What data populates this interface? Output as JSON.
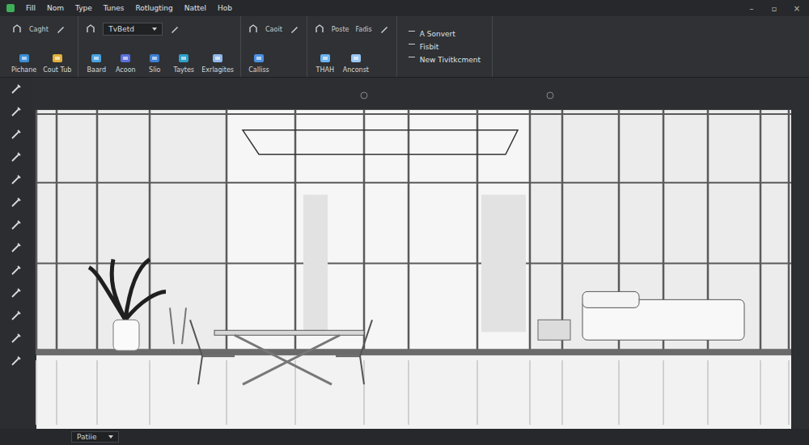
{
  "menu": [
    "Fill",
    "Nom",
    "Type",
    "Tunes",
    "Rotlugting",
    "Nattel",
    "Hob"
  ],
  "window_controls": [
    "–",
    "▫",
    "×"
  ],
  "ribbon": {
    "groups": [
      {
        "captions": [
          "Caght"
        ],
        "buttons": [
          "Pichane",
          "Cout Tub"
        ]
      },
      {
        "captions": [],
        "dropdown": "TvBetd",
        "buttons": [
          "Baard",
          "Acoon",
          "Slio",
          "Taytes",
          "Exrlagites"
        ]
      },
      {
        "captions": [
          "Caoit"
        ],
        "buttons": [
          "Calliss"
        ]
      },
      {
        "captions": [
          "Poste",
          "Fadis"
        ],
        "buttons": [
          "THAH",
          "Anconst"
        ]
      }
    ],
    "actions": [
      "A Sonvert",
      "Fisbit",
      "New Tivitkcment"
    ]
  },
  "status_bar": {
    "dropdown": "Patiie"
  }
}
